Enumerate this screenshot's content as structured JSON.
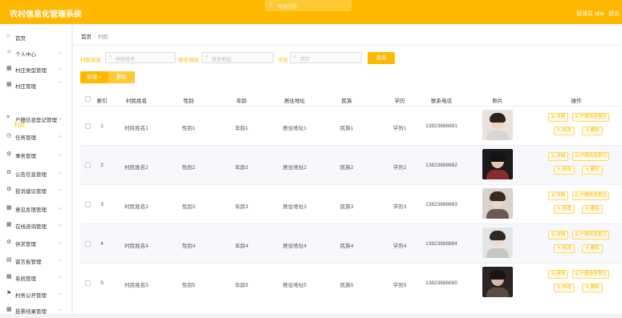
{
  "app": {
    "title": "农村信息化管理系统",
    "search_placeholder": "搜索内容",
    "user": "管理员 abo",
    "logout": "退出"
  },
  "sidebar": {
    "items": [
      {
        "icon": "home-icon",
        "glyph": "⌂",
        "label": "首页",
        "has_chevron": false
      },
      {
        "icon": "user-icon",
        "glyph": "☺",
        "label": "个人中心",
        "has_chevron": true
      },
      {
        "icon": "grid-icon",
        "glyph": "▦",
        "label": "村庄类型管理",
        "has_chevron": true
      },
      {
        "icon": "grid-icon",
        "glyph": "▦",
        "label": "村庄管理",
        "has_chevron": true
      },
      {
        "icon": "doc-icon",
        "glyph": "≡",
        "label": "户籍信息登记管理",
        "has_chevron": true
      },
      {
        "icon": "clock-icon",
        "glyph": "◷",
        "label": "任务管理",
        "has_chevron": true
      },
      {
        "icon": "gear-icon",
        "glyph": "⚙",
        "label": "事务管理",
        "has_chevron": true
      },
      {
        "icon": "gear-icon",
        "glyph": "⚙",
        "label": "公告信息管理",
        "has_chevron": true
      },
      {
        "icon": "gear-icon",
        "glyph": "⚙",
        "label": "投诉建议管理",
        "has_chevron": true
      },
      {
        "icon": "grid-icon",
        "glyph": "▦",
        "label": "意见反馈管理",
        "has_chevron": true
      },
      {
        "icon": "grid-icon",
        "glyph": "▦",
        "label": "在线咨询管理",
        "has_chevron": true
      },
      {
        "icon": "gear-icon",
        "glyph": "⚙",
        "label": "供求管理",
        "has_chevron": true
      },
      {
        "icon": "doc-icon",
        "glyph": "▤",
        "label": "留言板管理",
        "has_chevron": true
      },
      {
        "icon": "grid-icon",
        "glyph": "▦",
        "label": "系统管理",
        "has_chevron": true
      },
      {
        "icon": "flag-icon",
        "glyph": "⚑",
        "label": "村务公开管理",
        "has_chevron": true
      },
      {
        "icon": "grid-icon",
        "glyph": "▦",
        "label": "投票结果管理",
        "has_chevron": true
      }
    ],
    "active_sub": "村民"
  },
  "breadcrumb": {
    "home": "首页",
    "separator": "/",
    "current": "村民"
  },
  "filters": [
    {
      "label": "村民姓名",
      "placeholder": "村民姓名"
    },
    {
      "label": "居住地址",
      "placeholder": "居住地址"
    },
    {
      "label": "学历",
      "placeholder": "学历"
    }
  ],
  "buttons": {
    "query": "查询",
    "add": "新增",
    "batch_delete": "删除"
  },
  "table": {
    "headers": [
      "索引",
      "村民姓名",
      "性别",
      "年龄",
      "居住地址",
      "民族",
      "学历",
      "联系电话",
      "照片",
      "操作"
    ],
    "rows": [
      {
        "index": "1",
        "name": "村民姓名1",
        "gender": "性别1",
        "age": "年龄1",
        "address": "居住地址1",
        "ethnic": "民族1",
        "edu": "学历1",
        "phone": "13823888881",
        "photo": "avatar-male"
      },
      {
        "index": "2",
        "name": "村民姓名2",
        "gender": "性别2",
        "age": "年龄2",
        "address": "居住地址2",
        "ethnic": "民族2",
        "edu": "学历2",
        "phone": "13823888882",
        "photo": "avatar-male-dark"
      },
      {
        "index": "3",
        "name": "村民姓名3",
        "gender": "性别3",
        "age": "年龄3",
        "address": "居住地址3",
        "ethnic": "民族3",
        "edu": "学历3",
        "phone": "13823888883",
        "photo": "avatar-female"
      },
      {
        "index": "4",
        "name": "村民姓名4",
        "gender": "性别4",
        "age": "年龄4",
        "address": "居住地址4",
        "ethnic": "民族4",
        "edu": "学历4",
        "phone": "13823888884",
        "photo": "avatar-female-light"
      },
      {
        "index": "5",
        "name": "村民姓名5",
        "gender": "性别5",
        "age": "年龄5",
        "address": "居住地址5",
        "ethnic": "民族5",
        "edu": "学历5",
        "phone": "13823888885",
        "photo": "avatar-female-dark"
      }
    ],
    "actions": {
      "detail": "详情",
      "report": "户籍信息登记",
      "edit": "修改",
      "delete": "删除"
    }
  },
  "colors": {
    "accent": "#ffb800",
    "accent_light": "#ffc933"
  }
}
